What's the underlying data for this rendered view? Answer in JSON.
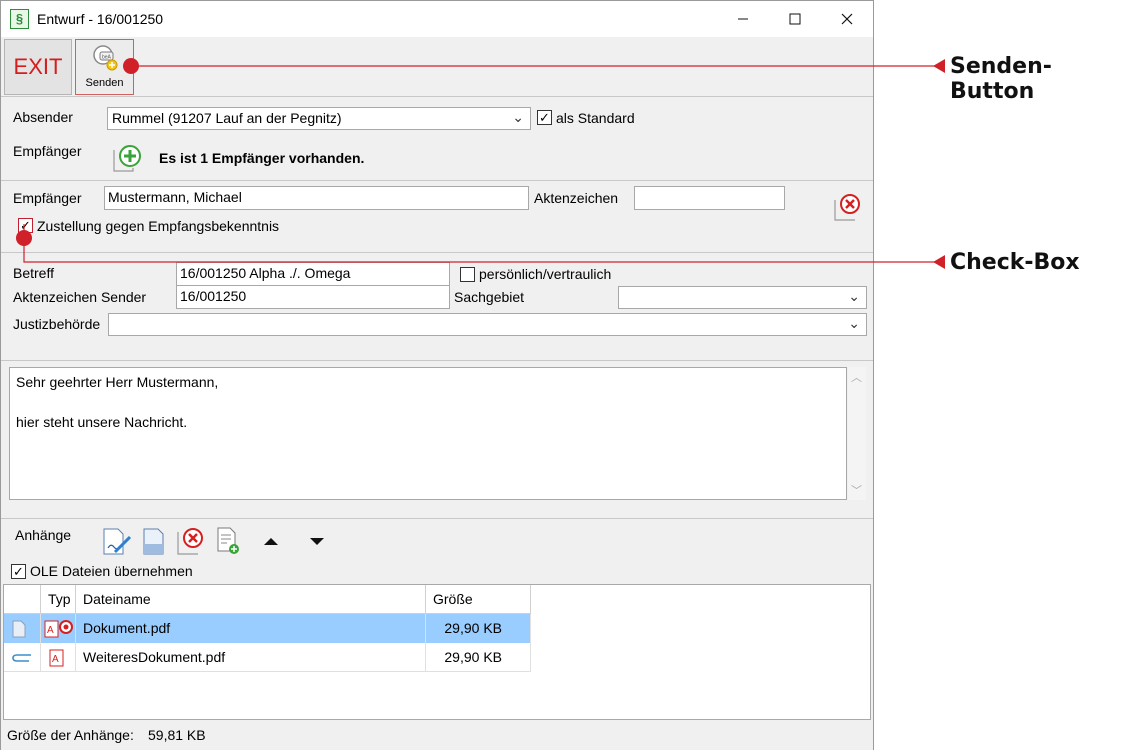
{
  "window": {
    "title": "Entwurf - 16/001250",
    "app_icon_glyph": "§"
  },
  "toolbar": {
    "exit_label": "EXIT",
    "senden_label": "Senden"
  },
  "header_section": {
    "absender_label": "Absender",
    "absender_value": "Rummel (91207 Lauf an der Pegnitz)",
    "als_standard_label": "als Standard",
    "als_standard_checked": true,
    "empfaenger_label": "Empfänger",
    "empfaenger_count_text": "Es ist 1 Empfänger vorhanden."
  },
  "recipient_section": {
    "empfaenger_label": "Empfänger",
    "empfaenger_value": "Mustermann, Michael",
    "aktenzeichen_label": "Aktenzeichen",
    "aktenzeichen_value": "",
    "zustellung_label": "Zustellung gegen Empfangsbekenntnis",
    "zustellung_checked": true
  },
  "details_section": {
    "betreff_label": "Betreff",
    "betreff_value": "16/001250 Alpha ./. Omega",
    "persoenlich_label": "persönlich/vertraulich",
    "persoenlich_checked": false,
    "aktenzeichen_sender_label": "Aktenzeichen Sender",
    "aktenzeichen_sender_value": "16/001250",
    "sachgebiet_label": "Sachgebiet",
    "sachgebiet_value": "",
    "justizbehoerde_label": "Justizbehörde",
    "justizbehoerde_value": ""
  },
  "message": {
    "line1": "Sehr geehrter Herr Mustermann,",
    "line2": "hier steht unsere Nachricht."
  },
  "attachments": {
    "label": "Anhänge",
    "toolbar_icons": [
      "edit-document-icon",
      "document-icon",
      "delete-icon",
      "add-document-icon",
      "move-up-icon",
      "move-down-icon"
    ],
    "ole_label": "OLE Dateien übernehmen",
    "ole_checked": true,
    "columns": [
      "",
      "Typ",
      "Dateiname",
      "Größe"
    ],
    "rows": [
      {
        "name": "Dokument.pdf",
        "size": "29,90 KB",
        "selected": true
      },
      {
        "name": "WeiteresDokument.pdf",
        "size": "29,90 KB",
        "selected": false
      }
    ]
  },
  "status": {
    "label": "Größe der Anhänge:",
    "value": "59,81 KB"
  },
  "annotations": {
    "senden_callout": "Senden-Button",
    "checkbox_callout": "Check-Box",
    "color": "#d0202a"
  }
}
